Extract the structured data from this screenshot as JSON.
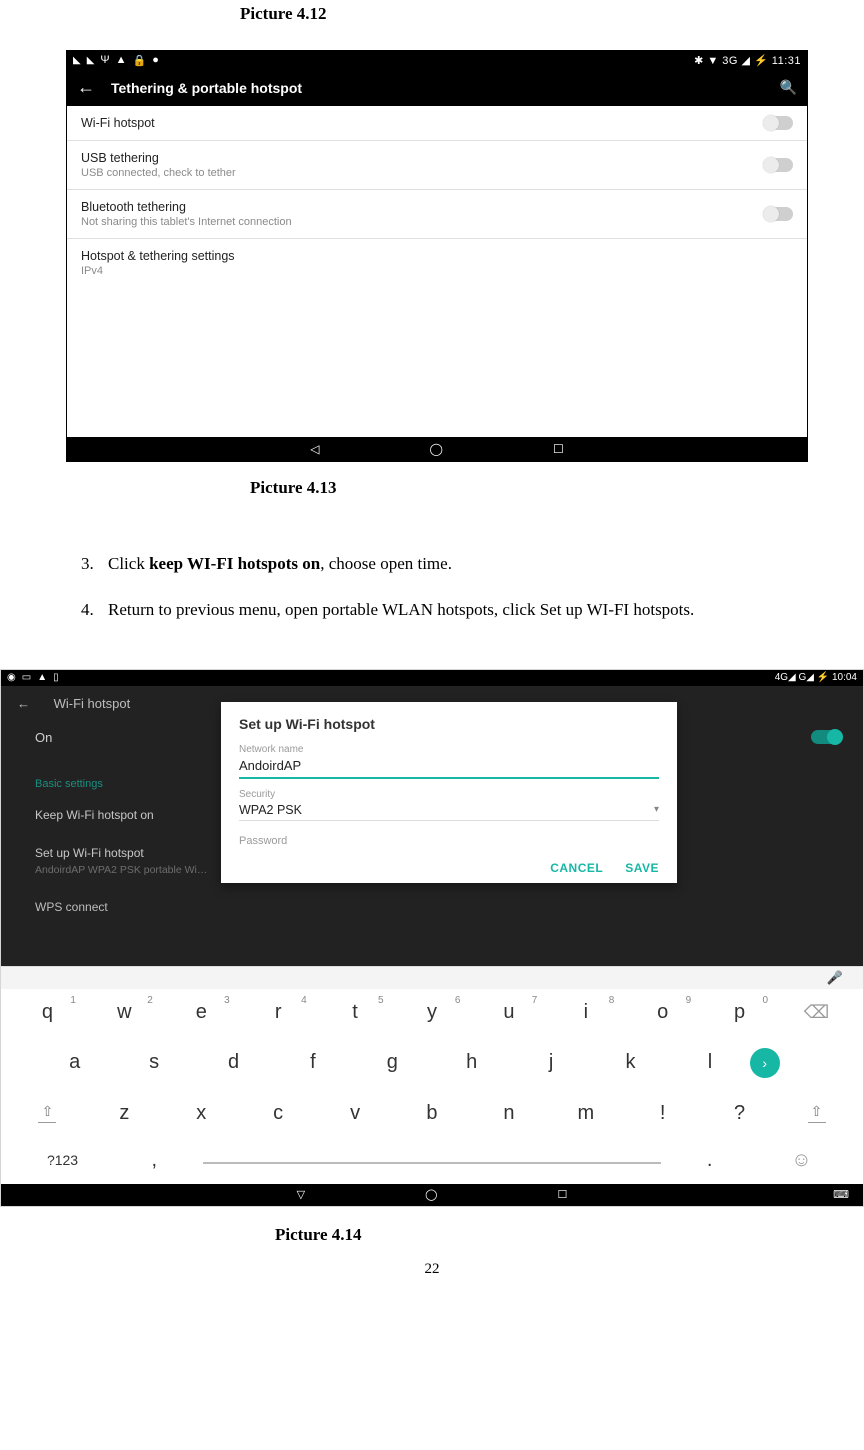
{
  "caption_412": "Picture 4.12",
  "caption_413": "Picture 4.13",
  "caption_414": "Picture 4.14",
  "page_number": "22",
  "steps": {
    "s3_pre": "Click ",
    "s3_bold": "keep WI-FI hotspots on",
    "s3_post": ", choose open time.",
    "s4": "Return to previous menu, open portable WLAN hotspots, click Set up WI-FI hotspots."
  },
  "shot1": {
    "status_right": "✱ ▼ 3G ◢ ⚡ 11:31",
    "title": "Tethering & portable hotspot",
    "items": [
      {
        "title": "Wi-Fi hotspot",
        "sub": ""
      },
      {
        "title": "USB tethering",
        "sub": "USB connected, check to tether"
      },
      {
        "title": "Bluetooth tethering",
        "sub": "Not sharing this tablet's Internet connection"
      },
      {
        "title": "Hotspot & tethering settings",
        "sub": "IPv4"
      }
    ]
  },
  "shot2": {
    "status_right": "4G◢ G◢ ⚡ 10:04",
    "back_title": "Wi-Fi hotspot",
    "on": "On",
    "basic": "Basic settings",
    "keep": "Keep Wi-Fi hotspot on",
    "setup": "Set up Wi-Fi hotspot",
    "setup_sub": "AndoirdAP WPA2 PSK portable Wi…",
    "wps": "WPS connect",
    "dialog": {
      "title": "Set up Wi-Fi hotspot",
      "net_label": "Network name",
      "net_value": "AndoirdAP",
      "sec_label": "Security",
      "sec_value": "WPA2 PSK",
      "pwd_label": "Password",
      "cancel": "CANCEL",
      "save": "SAVE"
    },
    "kbd": {
      "row1": [
        {
          "k": "q",
          "n": "1"
        },
        {
          "k": "w",
          "n": "2"
        },
        {
          "k": "e",
          "n": "3"
        },
        {
          "k": "r",
          "n": "4"
        },
        {
          "k": "t",
          "n": "5"
        },
        {
          "k": "y",
          "n": "6"
        },
        {
          "k": "u",
          "n": "7"
        },
        {
          "k": "i",
          "n": "8"
        },
        {
          "k": "o",
          "n": "9"
        },
        {
          "k": "p",
          "n": "0"
        }
      ],
      "row2": [
        "a",
        "s",
        "d",
        "f",
        "g",
        "h",
        "j",
        "k",
        "l"
      ],
      "row3": [
        "z",
        "x",
        "c",
        "v",
        "b",
        "n",
        "m",
        "!",
        "?"
      ],
      "sym": "?123"
    }
  }
}
